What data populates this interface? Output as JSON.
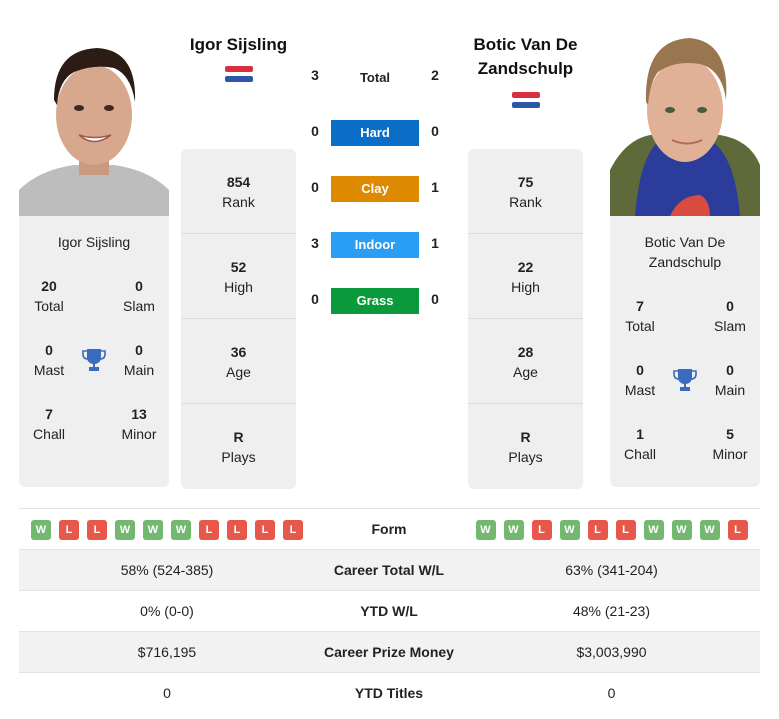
{
  "player1": {
    "name": "Igor Sijsling",
    "card_name": "Igor Sijsling",
    "flag": "netherlands-flag",
    "titles": {
      "total": {
        "value": "20",
        "label": "Total"
      },
      "slam": {
        "value": "0",
        "label": "Slam"
      },
      "mast": {
        "value": "0",
        "label": "Mast"
      },
      "main": {
        "value": "0",
        "label": "Main"
      },
      "chall": {
        "value": "7",
        "label": "Chall"
      },
      "minor": {
        "value": "13",
        "label": "Minor"
      }
    },
    "stats": [
      {
        "value": "854",
        "label": "Rank"
      },
      {
        "value": "52",
        "label": "High"
      },
      {
        "value": "36",
        "label": "Age"
      },
      {
        "value": "R",
        "label": "Plays"
      }
    ],
    "form": [
      "W",
      "L",
      "L",
      "W",
      "W",
      "W",
      "L",
      "L",
      "L",
      "L"
    ]
  },
  "player2": {
    "name": "Botic Van De Zandschulp",
    "card_name": "Botic Van De Zandschulp",
    "flag": "netherlands-flag",
    "titles": {
      "total": {
        "value": "7",
        "label": "Total"
      },
      "slam": {
        "value": "0",
        "label": "Slam"
      },
      "mast": {
        "value": "0",
        "label": "Mast"
      },
      "main": {
        "value": "0",
        "label": "Main"
      },
      "chall": {
        "value": "1",
        "label": "Chall"
      },
      "minor": {
        "value": "5",
        "label": "Minor"
      }
    },
    "stats": [
      {
        "value": "75",
        "label": "Rank"
      },
      {
        "value": "22",
        "label": "High"
      },
      {
        "value": "28",
        "label": "Age"
      },
      {
        "value": "R",
        "label": "Plays"
      }
    ],
    "form": [
      "W",
      "W",
      "L",
      "W",
      "L",
      "L",
      "W",
      "W",
      "W",
      "L"
    ]
  },
  "h2h": {
    "total": {
      "label": "Total",
      "p1": "3",
      "p2": "2"
    },
    "surfaces": [
      {
        "label": "Hard",
        "p1": "0",
        "p2": "0",
        "color": "#0a6ec7"
      },
      {
        "label": "Clay",
        "p1": "0",
        "p2": "1",
        "color": "#dd8a00"
      },
      {
        "label": "Indoor",
        "p1": "3",
        "p2": "1",
        "color": "#2a9ef5"
      },
      {
        "label": "Grass",
        "p1": "0",
        "p2": "0",
        "color": "#0b9a3b"
      }
    ]
  },
  "comparison": {
    "form_label": "Form",
    "rows": [
      {
        "label": "Career Total W/L",
        "p1": "58% (524-385)",
        "p2": "63% (341-204)"
      },
      {
        "label": "YTD W/L",
        "p1": "0% (0-0)",
        "p2": "48% (21-23)"
      },
      {
        "label": "Career Prize Money",
        "p1": "$716,195",
        "p2": "$3,003,990"
      },
      {
        "label": "YTD Titles",
        "p1": "0",
        "p2": "0"
      }
    ]
  },
  "colors": {
    "win": "#72b86e",
    "loss": "#e8584a",
    "trophy": "#3a6bbf",
    "card_bg": "#efefef"
  }
}
